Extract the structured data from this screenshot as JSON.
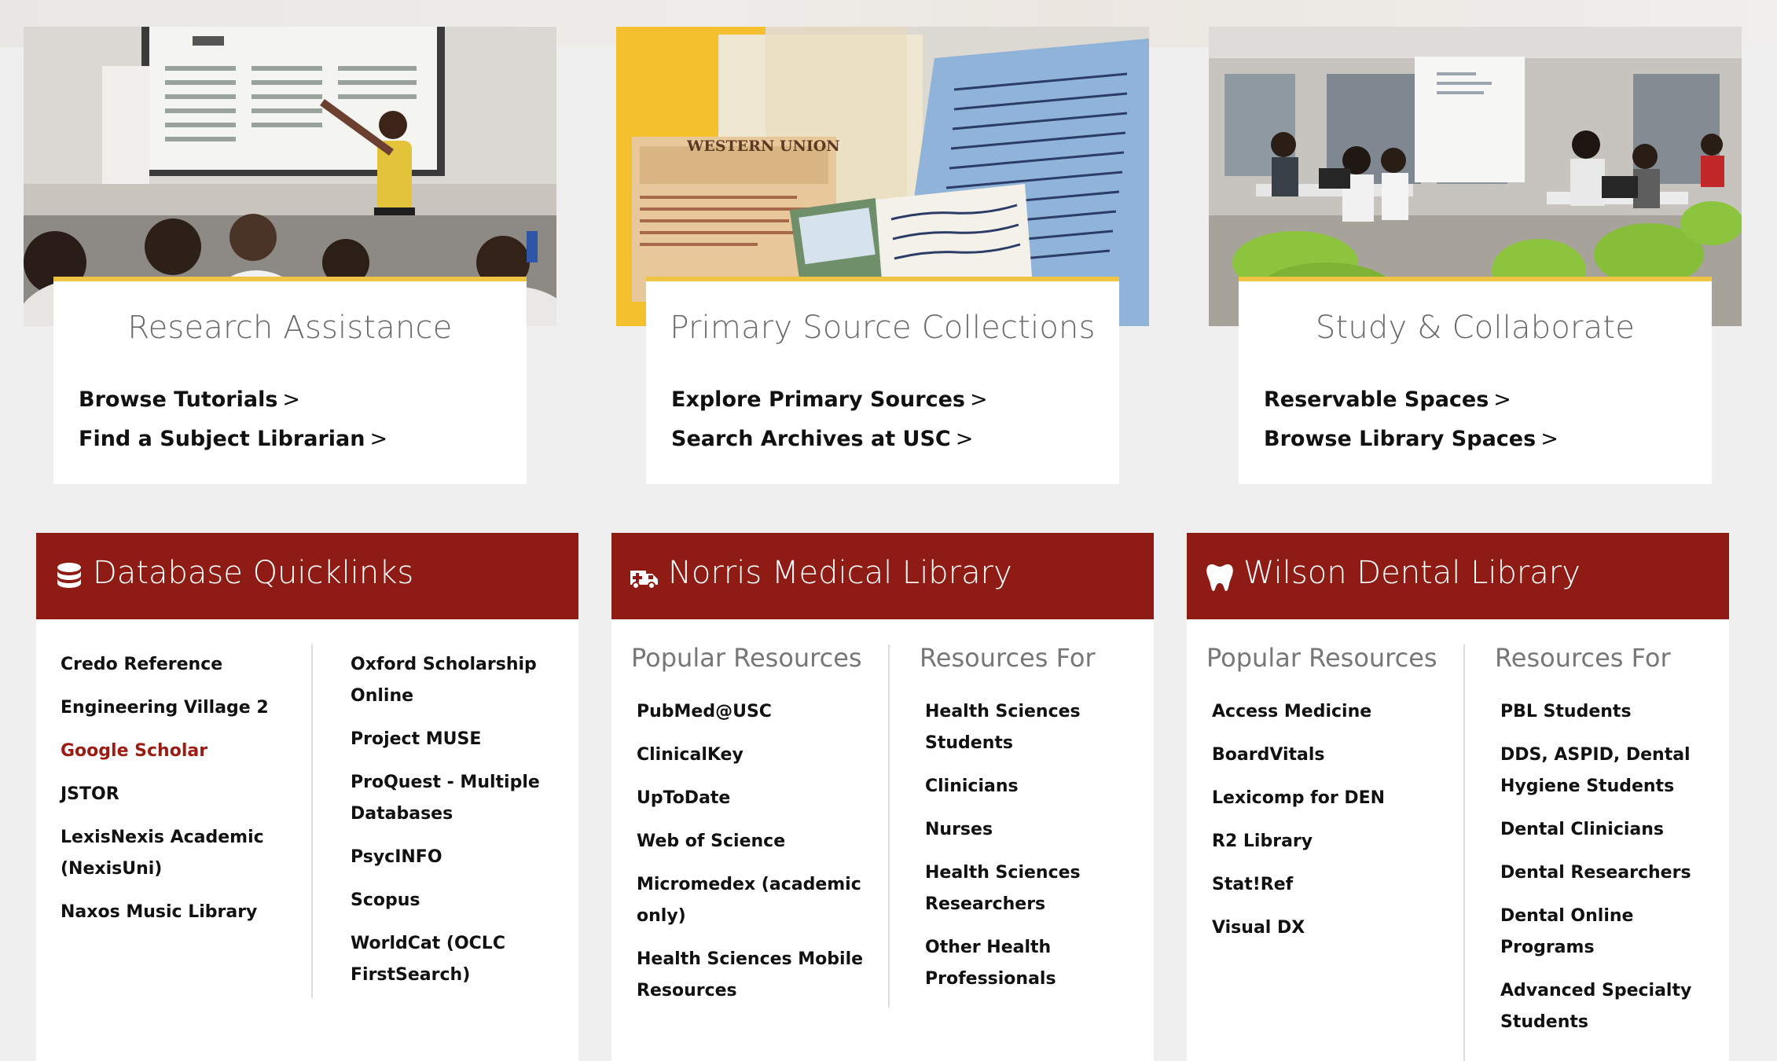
{
  "features": [
    {
      "title": "Research Assistance",
      "links": [
        "Browse Tutorials",
        "Find a Subject Librarian"
      ]
    },
    {
      "title": "Primary Source Collections",
      "links": [
        "Explore Primary Sources",
        "Search Archives at USC"
      ],
      "photo_text": {
        "telegram_brand": "WESTERN UNION"
      }
    },
    {
      "title": "Study & Collaborate",
      "links": [
        "Reservable Spaces",
        "Browse Library Spaces"
      ]
    }
  ],
  "chevron": ">",
  "database": {
    "title": "Database Quicklinks",
    "icon": "database-icon",
    "col1": [
      "Credo Reference",
      "Engineering Village 2",
      "Google Scholar",
      "JSTOR",
      "LexisNexis Academic (NexisUni)",
      "Naxos Music Library"
    ],
    "col2": [
      "Oxford Scholarship Online",
      "Project MUSE",
      "ProQuest - Multiple Databases",
      "PsycINFO",
      "Scopus",
      "WorldCat (OCLC FirstSearch)"
    ],
    "accent_item": "Google Scholar"
  },
  "norris": {
    "title": "Norris Medical Library",
    "icon": "ambulance-icon",
    "col1_head": "Popular Resources",
    "col1": [
      "PubMed@USC",
      "ClinicalKey",
      "UpToDate",
      "Web of Science",
      "Micromedex (academic only)",
      "Health Sciences Mobile Resources"
    ],
    "col2_head": "Resources For",
    "col2": [
      "Health Sciences Students",
      "Clinicians",
      "Nurses",
      "Health Sciences Researchers",
      "Other Health Professionals"
    ]
  },
  "wilson": {
    "title": "Wilson Dental Library",
    "icon": "tooth-icon",
    "col1_head": "Popular Resources",
    "col1": [
      "Access Medicine",
      "BoardVitals",
      "Lexicomp for DEN",
      "R2 Library",
      "Stat!Ref",
      "Visual DX"
    ],
    "col2_head": "Resources For",
    "col2": [
      "PBL Students",
      "DDS, ASPID, Dental Hygiene Students",
      "Dental Clinicians",
      "Dental Researchers",
      "Dental Online Programs",
      "Advanced Specialty Students"
    ]
  },
  "colors": {
    "brand_red": "#8e1b14",
    "accent_gold": "#f0c443",
    "link_accent": "#9b1c12"
  }
}
